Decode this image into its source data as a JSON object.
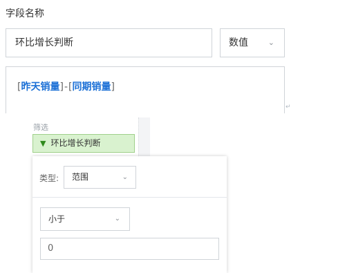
{
  "field": {
    "label": "字段名称",
    "name_value": "环比增长判断",
    "type_selected": "数值"
  },
  "formula": {
    "open_bracket_1": "[",
    "field_1": "昨天销量",
    "close_bracket_1": "]",
    "operator": "-",
    "open_bracket_2": "[",
    "field_2": "同期销量",
    "close_bracket_2": "]",
    "return_mark": "↵"
  },
  "filter": {
    "section_label": "筛选",
    "chip_label": "环比增长判断",
    "kind_label": "类型:",
    "kind_selected": "范围",
    "compare_selected": "小于",
    "value": "0"
  },
  "icons": {
    "chevron": "chevron-down-icon",
    "funnel": "funnel-icon",
    "return_mark": "return-mark-icon"
  },
  "colors": {
    "accent": "#1a6fd6",
    "chip_bg": "#d9f2cf",
    "chip_border": "#9fd08a",
    "funnel": "#2f8a1c",
    "border": "#cfd3d8"
  }
}
